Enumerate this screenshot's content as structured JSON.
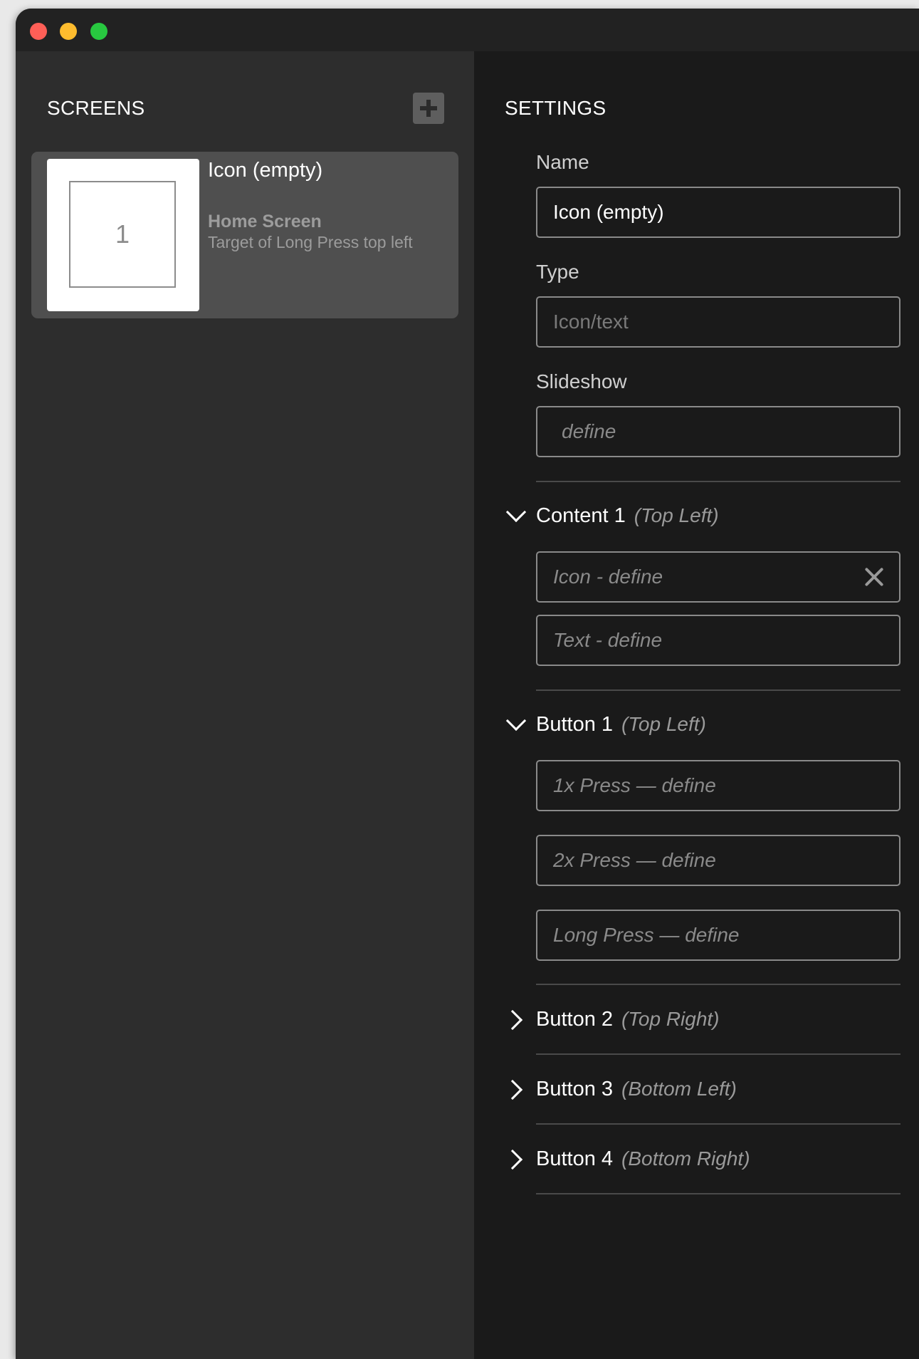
{
  "window": {
    "traffic_lights": {
      "close": "#ff5f57",
      "minimize": "#febc2e",
      "zoom": "#28c840"
    }
  },
  "sidebar": {
    "title": "SCREENS",
    "add_icon": "plus-icon",
    "screens": [
      {
        "thumb_number": "1",
        "name": "Icon (empty)",
        "target": "Home Screen",
        "description": "Target of Long Press top left"
      }
    ]
  },
  "settings": {
    "title": "SETTINGS",
    "name_label": "Name",
    "name_value": "Icon (empty)",
    "type_label": "Type",
    "type_placeholder": "Icon/text",
    "slideshow_label": "Slideshow",
    "slideshow_placeholder": "define",
    "content1": {
      "name": "Content 1",
      "position": "(Top Left)",
      "expanded": true,
      "icon_placeholder": "Icon - define",
      "text_placeholder": "Text - define"
    },
    "button1": {
      "name": "Button 1",
      "position": "(Top Left)",
      "expanded": true,
      "press1": "1x Press — define",
      "press2": "2x Press — define",
      "long_press": "Long Press — define"
    },
    "button2": {
      "name": "Button 2",
      "position": "(Top Right)",
      "expanded": false
    },
    "button3": {
      "name": "Button 3",
      "position": "(Bottom Left)",
      "expanded": false
    },
    "button4": {
      "name": "Button 4",
      "position": "(Bottom Right)",
      "expanded": false
    }
  }
}
